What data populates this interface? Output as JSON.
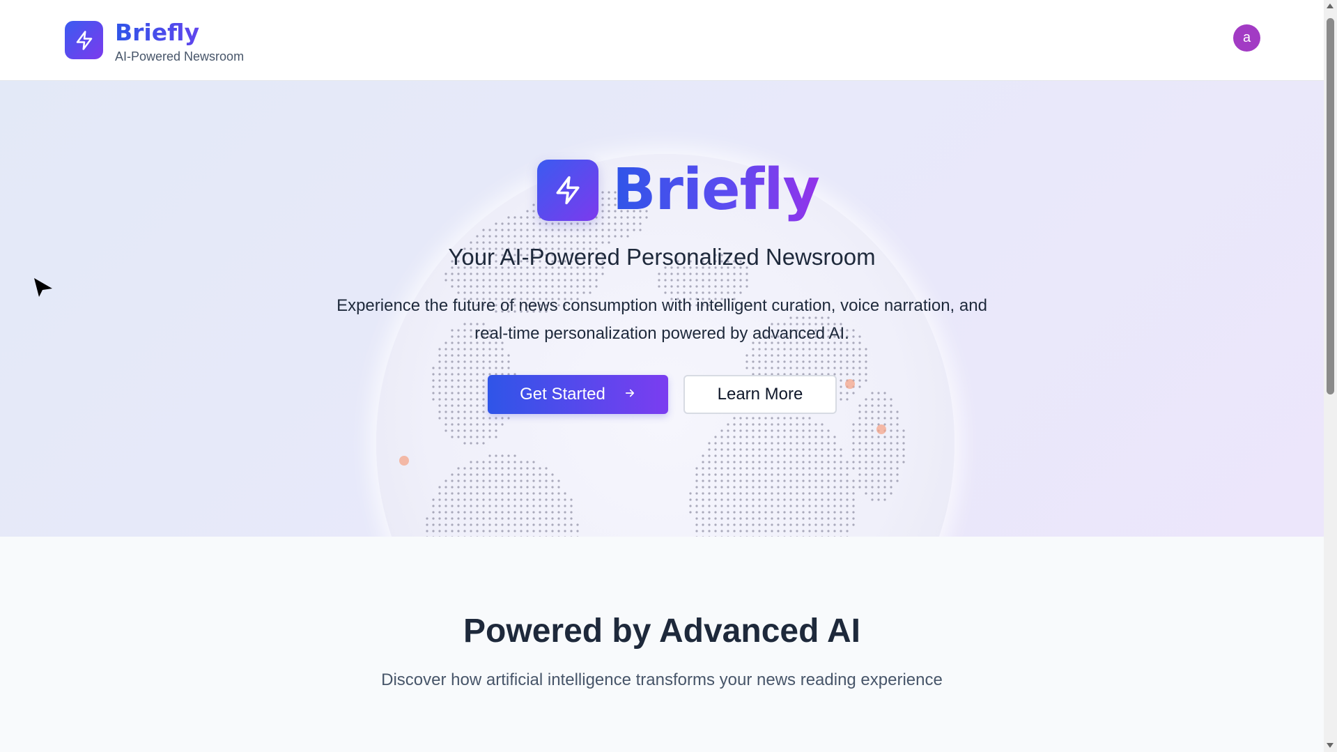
{
  "header": {
    "brand_name": "Briefly",
    "brand_subtitle": "AI-Powered Newsroom",
    "logo_icon": "lightning-bolt-icon",
    "avatar_initial": "a",
    "avatar_color": "#a23bc4"
  },
  "hero": {
    "title": "Briefly",
    "tagline": "Your AI-Powered Personalized Newsroom",
    "description": "Experience the future of news consumption with intelligent curation, voice narration, and real-time personalization powered by advanced AI.",
    "primary_button": "Get Started",
    "secondary_button": "Learn More",
    "globe_icon": "globe-dots-icon"
  },
  "features": {
    "title": "Powered by Advanced AI",
    "subtitle": "Discover how artificial intelligence transforms your news reading experience"
  },
  "colors": {
    "accent_blue": "#2f55e8",
    "accent_purple": "#7b3df0",
    "text_dark": "#1e293b"
  }
}
